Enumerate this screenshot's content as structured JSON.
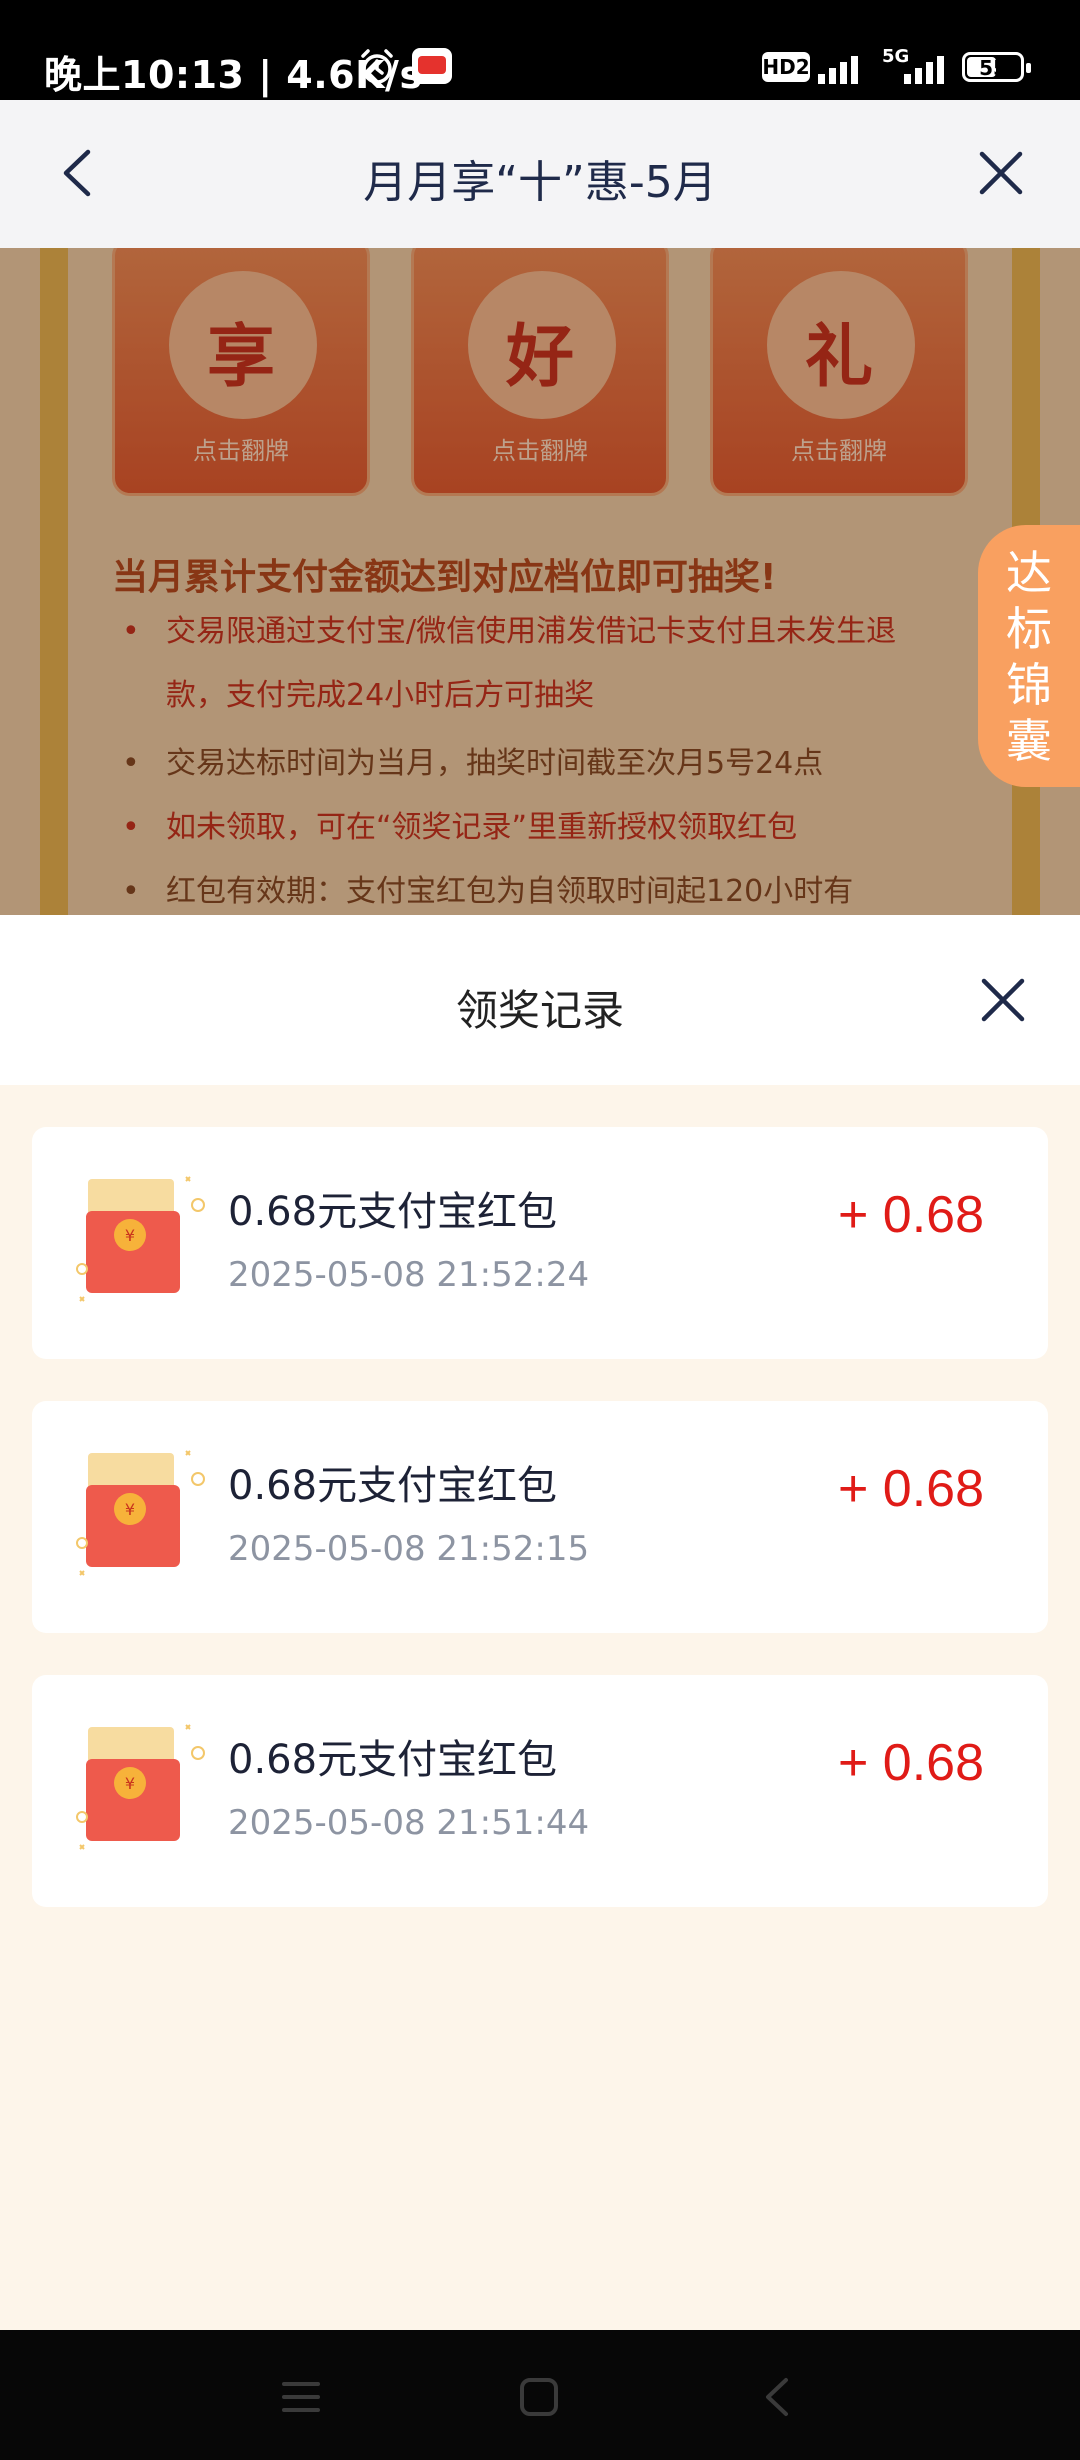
{
  "status_bar": {
    "time": "晚上10:13 | 4.6K/s",
    "hd_label": "HD2",
    "network": "5G",
    "battery": "55",
    "battery_level_percent": 55
  },
  "nav": {
    "title": "月月享“十”惠-5月"
  },
  "background_page": {
    "cards": [
      {
        "char": "享",
        "hint": "点击翻牌"
      },
      {
        "char": "好",
        "hint": "点击翻牌"
      },
      {
        "char": "礼",
        "hint": "点击翻牌"
      }
    ],
    "heading": "当月累计支付金额达到对应档位即可抽奖!",
    "rules": [
      {
        "bullet": "•",
        "text": "交易限通过支付宝/微信使用浦发借记卡支付且未发生退款，支付完成24小时后方可抽奖"
      },
      {
        "bullet": "•",
        "text": "交易达标时间为当月，抽奖时间截至次月5号24点"
      },
      {
        "bullet": "•",
        "text": "如未领取，可在“领奖记录”里重新授权领取红包"
      },
      {
        "bullet": "•",
        "text": "红包有效期：支付宝红包为自领取时间起120小时有"
      }
    ],
    "floating_tab": "达标锦囊"
  },
  "sheet": {
    "title": "领奖记录",
    "records": [
      {
        "title": "0.68元支付宝红包",
        "time": "2025-05-08 21:52:24",
        "amount": "+ 0.68"
      },
      {
        "title": "0.68元支付宝红包",
        "time": "2025-05-08 21:52:15",
        "amount": "+ 0.68"
      },
      {
        "title": "0.68元支付宝红包",
        "time": "2025-05-08 21:51:44",
        "amount": "+ 0.68"
      }
    ]
  },
  "colors": {
    "amount_red": "#e01b17",
    "title_navy": "#1f2a4a",
    "sheet_bg": "#fdf5ea"
  }
}
